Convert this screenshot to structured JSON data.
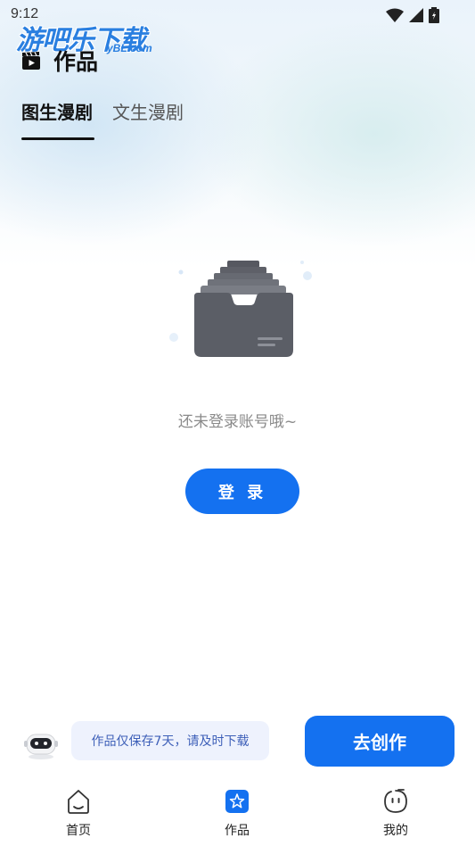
{
  "status_bar": {
    "time": "9:12"
  },
  "watermark": {
    "main": "游吧乐下载",
    "sub": "yBL.com"
  },
  "header": {
    "title": "作品",
    "icon": "clapperboard-icon"
  },
  "tabs": [
    {
      "label": "图生漫剧",
      "active": true
    },
    {
      "label": "文生漫剧",
      "active": false
    }
  ],
  "empty_state": {
    "illustration": "empty-inbox-icon",
    "message": "还未登录账号哦~",
    "login_label": "登 录"
  },
  "bottom_bar": {
    "notice": "作品仅保存7天，请及时下载",
    "create_label": "去创作",
    "robot_icon": "robot-icon"
  },
  "nav": [
    {
      "label": "首页",
      "icon": "home-icon"
    },
    {
      "label": "作品",
      "icon": "works-star-icon",
      "active": true
    },
    {
      "label": "我的",
      "icon": "smiley-face-icon"
    }
  ],
  "colors": {
    "accent": "#1471f0",
    "notice_bg": "#eef2fd",
    "notice_text": "#3d5fb8"
  }
}
